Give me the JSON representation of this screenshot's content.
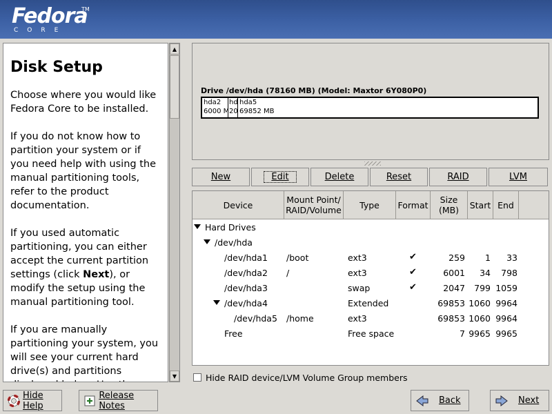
{
  "header": {
    "logo_text": "Fedora",
    "logo_tm": "TM",
    "logo_sub": "CORE"
  },
  "help": {
    "title": "Disk Setup",
    "paragraphs": [
      "Choose where you would like Fedora Core to be installed.",
      "If you do not know how to partition your system or if you need help with using the manual partitioning tools, refer to the product documentation.",
      "If you used automatic partitioning, you can either accept the current partition settings (click ",
      "If you are manually partitioning your system, you will see your current hard drive(s) and partitions displayed below. Use the partitioning tool to add, edit,"
    ],
    "next_word": "Next",
    "para3_tail": "), or modify the setup using the manual partitioning tool."
  },
  "drive": {
    "label": "Drive /dev/hda (78160 MB) (Model: Maxtor 6Y080P0)",
    "segments": [
      {
        "name": "hda2",
        "size": "6000 M"
      },
      {
        "name": "hd",
        "size": "20"
      },
      {
        "name": "hda5",
        "size": "69852 MB"
      }
    ]
  },
  "toolbar": {
    "new": "New",
    "edit": "Edit",
    "delete": "Delete",
    "reset": "Reset",
    "raid": "RAID",
    "lvm": "LVM"
  },
  "table": {
    "headers": {
      "device": "Device",
      "mount": "Mount Point/ RAID/Volume",
      "type": "Type",
      "format": "Format",
      "size": "Size (MB)",
      "start": "Start",
      "end": "End"
    },
    "group_hard_drives": "Hard Drives",
    "group_hda": "/dev/hda",
    "rows": [
      {
        "device": "/dev/hda1",
        "mount": "/boot",
        "type": "ext3",
        "format": "✔",
        "size": "259",
        "start": "1",
        "end": "33"
      },
      {
        "device": "/dev/hda2",
        "mount": "/",
        "type": "ext3",
        "format": "✔",
        "size": "6001",
        "start": "34",
        "end": "798"
      },
      {
        "device": "/dev/hda3",
        "mount": "",
        "type": "swap",
        "format": "✔",
        "size": "2047",
        "start": "799",
        "end": "1059"
      },
      {
        "device": "/dev/hda4",
        "mount": "",
        "type": "Extended",
        "format": "",
        "size": "69853",
        "start": "1060",
        "end": "9964"
      },
      {
        "device": "/dev/hda5",
        "mount": "/home",
        "type": "ext3",
        "format": "",
        "size": "69853",
        "start": "1060",
        "end": "9964"
      },
      {
        "device": "Free",
        "mount": "",
        "type": "Free space",
        "format": "",
        "size": "7",
        "start": "9965",
        "end": "9965"
      }
    ]
  },
  "hide_raid_label": "Hide RAID device/LVM Volume Group members",
  "buttons": {
    "hide_help": "Hide Help",
    "release_notes": "Release Notes",
    "back": "Back",
    "next": "Next"
  }
}
